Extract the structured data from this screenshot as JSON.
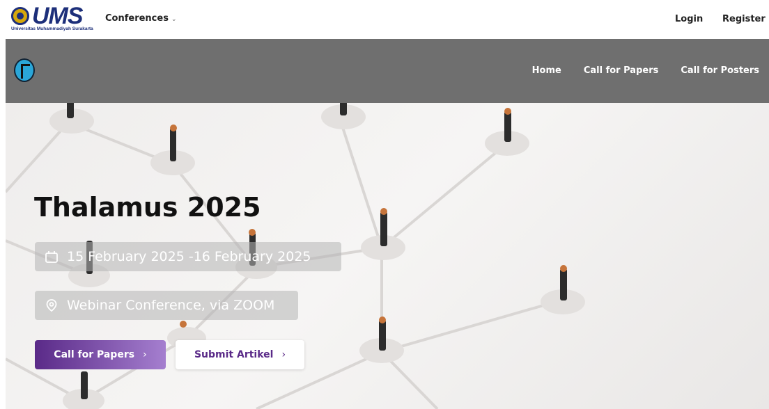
{
  "navbar": {
    "logo_text": "UMS",
    "logo_subtext": "Universitas Muhammadiyah Surakarta",
    "conferences_label": "Conferences",
    "login_label": "Login",
    "register_label": "Register"
  },
  "conference_nav": {
    "items": [
      {
        "label": "Home"
      },
      {
        "label": "Call for Papers"
      },
      {
        "label": "Call for Posters"
      }
    ]
  },
  "hero": {
    "title": "Thalamus 2025",
    "date": "15 February 2025 -16 February 2025",
    "location": "Webinar Conference, via ZOOM",
    "primary_button": "Call for Papers",
    "secondary_button": "Submit Artikel",
    "arrow_glyph": "›"
  },
  "colors": {
    "brand_blue": "#1d2f7a",
    "accent_purple": "#5a2a88",
    "header_grey": "#6f6f6f"
  },
  "icons": {
    "calendar": "calendar-icon",
    "location": "map-pin-icon",
    "dropdown": "chevron-down-icon"
  }
}
